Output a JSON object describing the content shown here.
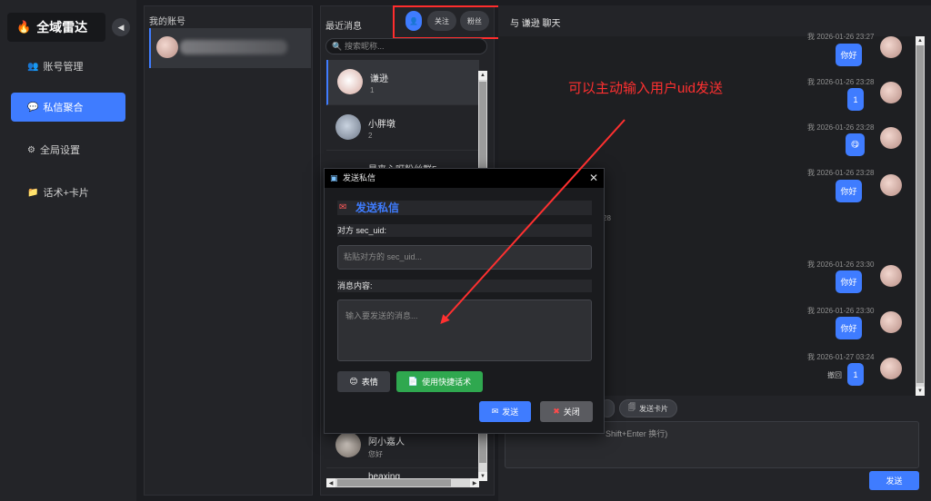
{
  "sidebar": {
    "brand": "全域雷达",
    "collapse_icon": "◀",
    "items": [
      {
        "label": "账号管理",
        "icon": "👥"
      },
      {
        "label": "私信聚合",
        "icon": "💬",
        "active": true
      },
      {
        "label": "全局设置",
        "icon": "⚙"
      },
      {
        "label": "话术+卡片",
        "icon": "📁"
      }
    ]
  },
  "accounts": {
    "title": "我的账号"
  },
  "recent": {
    "title": "最近消息",
    "segments": [
      {
        "label": "👤",
        "active": true
      },
      {
        "label": "关注"
      },
      {
        "label": "粉丝"
      }
    ],
    "search_placeholder": "搜索昵称...",
    "conversations": [
      {
        "name": "谦逊",
        "sub": "1",
        "active": true
      },
      {
        "name": "小胖墩",
        "sub": "2"
      },
      {
        "name": "是来心呀粉丝群5",
        "sub": ""
      },
      {
        "name": "阿小嘉人",
        "sub": "您好"
      },
      {
        "name": "heaxing",
        "sub": ""
      }
    ]
  },
  "chat": {
    "header": "与 谦逊 聊天",
    "messages": [
      {
        "time": "2026-01-26 23:27",
        "text": "你好"
      },
      {
        "time": "2026-01-26 23:28",
        "text": "1"
      },
      {
        "time": "2026-01-26 23:28",
        "text": "😋"
      },
      {
        "time": "2026-01-26 23:28",
        "text": "你好"
      },
      {
        "time": "2026-01-26 23:30",
        "text": "你好"
      },
      {
        "time": "2026-01-26 23:30",
        "text": "你好"
      },
      {
        "time": "2026-01-27 03:24",
        "text": "1",
        "recall": "撤回"
      }
    ],
    "me_prefix": "我",
    "stray_text": "28",
    "toolbar": {
      "send_card": "发送卡片"
    },
    "input_hint": "Shift+Enter 换行)",
    "send": "发送"
  },
  "modal": {
    "title": "发送私信",
    "heading": "发送私信",
    "uid_label": "对方 sec_uid:",
    "uid_placeholder": "粘贴对方的 sec_uid...",
    "content_label": "消息内容:",
    "content_placeholder": "输入要发送的消息...",
    "emoji_btn": "表情",
    "quick_btn": "使用快捷话术",
    "send_btn": "发送",
    "close_btn": "关闭"
  },
  "annotation": {
    "text": "可以主动输入用户uid发送",
    "color": "#ff3030"
  },
  "colors": {
    "accent": "#3f7cff",
    "highlight_box": "#ff2d2d",
    "green": "#2fa84f",
    "danger": "#5a5b60"
  }
}
